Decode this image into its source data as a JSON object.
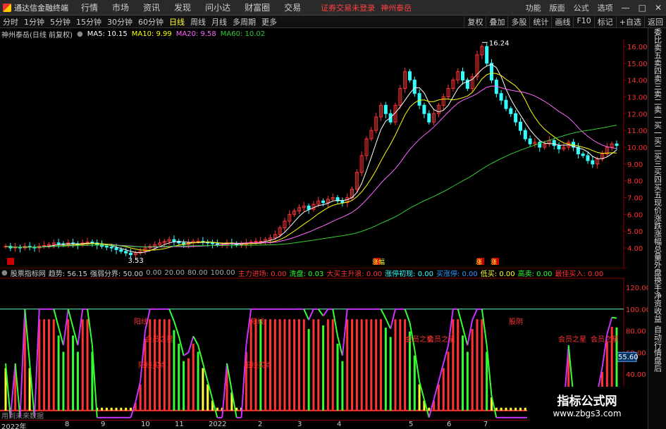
{
  "app": {
    "title": "通达信金融终端"
  },
  "menu": [
    "行情",
    "市场",
    "资讯",
    "发现",
    "问小达",
    "财富圈",
    "交易"
  ],
  "notice": "证券交易未登录",
  "stock_name_top": "神州泰岳",
  "menu_right": [
    "功能",
    "版面",
    "公式",
    "选项"
  ],
  "window_buttons": [
    "—",
    "□",
    "✕"
  ],
  "periods": [
    "分时",
    "1分钟",
    "5分钟",
    "15分钟",
    "30分钟",
    "60分钟",
    "日线",
    "周线",
    "月线",
    "多周期",
    "更多"
  ],
  "active_period": "日线",
  "tools": [
    "复权",
    "叠加",
    "多股",
    "统计",
    "画线",
    "F10",
    "标记",
    "+自选",
    "返回"
  ],
  "info": {
    "stock": "神州泰岳(日线 前复权)",
    "ma5": "MA5: 10.15",
    "ma10": "MA10: 9.99",
    "ma20": "MA20: 9.58",
    "ma60": "MA60: 10.02"
  },
  "colors": {
    "up": "#ff3333",
    "down": "#33ffff",
    "ma5": "#ffffff",
    "ma10": "#ffff00",
    "ma20": "#ff66ff",
    "ma60": "#33cc33",
    "grid": "#8a0000"
  },
  "side_panel": [
    "委比",
    "卖五",
    "卖四",
    "卖三",
    "卖二",
    "卖一",
    "买一",
    "买二",
    "买三",
    "买四",
    "买五",
    "现价",
    "涨跌",
    "涨幅",
    "总量",
    "外盘",
    "换手",
    "净资",
    "收益"
  ],
  "side_panel2": [
    "自动",
    "行情",
    "盘后"
  ],
  "side_times": [
    "14:50",
    "14:50",
    "14:50",
    "14:50",
    "14:50",
    "14:50",
    "14:56"
  ],
  "price_axis": [
    "16.00",
    "15.00",
    "14.00",
    "13.00",
    "12.00",
    "11.00",
    "10.00",
    "9.00",
    "8.00",
    "7.00",
    "6.00",
    "5.00",
    "4.00"
  ],
  "annotations": {
    "high": "16.24",
    "low": "3.53"
  },
  "indicator": {
    "name": "股票指标网",
    "trend": "趋势: 56.15",
    "strength": "强弱分界: 50.00",
    "levels": [
      "0.00",
      "20.00",
      "80.00",
      "100.00"
    ],
    "zhuli": "主力进场: 0.00",
    "xipan": "洗盘: 0.03",
    "dakaishang": "大买主升浪: 0.00",
    "zhangting": "涨停初现: 0.00",
    "maizhang": "买涨停: 0.00",
    "dimai": "低买: 0.00",
    "gaomai": "高卖: 0.00",
    "zuijia": "最佳买入: 0.00"
  },
  "ind_axis": [
    "120.00",
    "100.00",
    "80.00",
    "60.00",
    "40.00",
    "20.00"
  ],
  "ind_current": "55.60",
  "signals": [
    "阳线",
    "阳线",
    "股阴",
    "会员之星",
    "会员之星",
    "会员之星",
    "会员之星",
    "会员之星",
    "阳线买点",
    "阳线买点"
  ],
  "red_boxes": [
    "涨幅",
    "涨",
    "涨"
  ],
  "bottom_note": "用到未来数据",
  "time_labels": [
    "2022年",
    "8",
    "9",
    "10",
    "11",
    "2022",
    "2",
    "3",
    "4",
    "5",
    "6",
    "7"
  ],
  "watermark": {
    "title": "指标公式网",
    "url": "www.zbgs3.com"
  },
  "chart_data": {
    "type": "candlestick",
    "title": "",
    "ylim": [
      3.0,
      17.0
    ],
    "close": [
      4.1,
      4.0,
      4.05,
      4.0,
      4.1,
      4.05,
      4.0,
      4.1,
      4.15,
      4.2,
      4.3,
      4.25,
      4.2,
      4.3,
      4.25,
      4.2,
      4.3,
      4.35,
      4.3,
      4.2,
      4.1,
      4.05,
      4.0,
      3.9,
      3.8,
      3.7,
      3.6,
      3.7,
      3.8,
      4.0,
      4.1,
      4.2,
      4.3,
      4.4,
      4.5,
      4.4,
      4.3,
      4.2,
      4.3,
      4.4,
      4.4,
      4.35,
      4.3,
      4.25,
      4.2,
      4.2,
      4.3,
      4.25,
      4.2,
      4.2,
      4.3,
      4.35,
      4.4,
      4.4,
      4.5,
      4.6,
      4.8,
      5.2,
      5.6,
      6.0,
      6.2,
      6.4,
      6.5,
      6.3,
      6.6,
      6.8,
      6.7,
      6.9,
      7.0,
      6.8,
      6.7,
      7.0,
      7.5,
      8.5,
      9.5,
      10.5,
      11.0,
      11.8,
      12.5,
      12.0,
      11.5,
      12.5,
      13.5,
      14.5,
      14.0,
      13.2,
      12.5,
      12.0,
      11.5,
      12.0,
      12.5,
      13.0,
      13.5,
      14.0,
      14.5,
      14.0,
      13.5,
      14.2,
      15.5,
      16.0,
      15.0,
      14.0,
      13.2,
      12.8,
      12.3,
      12.0,
      11.5,
      11.0,
      10.5,
      10.2,
      10.3,
      10.0,
      10.2,
      10.4,
      10.1,
      9.9,
      10.0,
      10.3,
      10.0,
      9.6,
      9.5,
      9.2,
      9.0,
      9.3,
      9.6,
      10.0,
      10.2,
      10.1
    ]
  }
}
